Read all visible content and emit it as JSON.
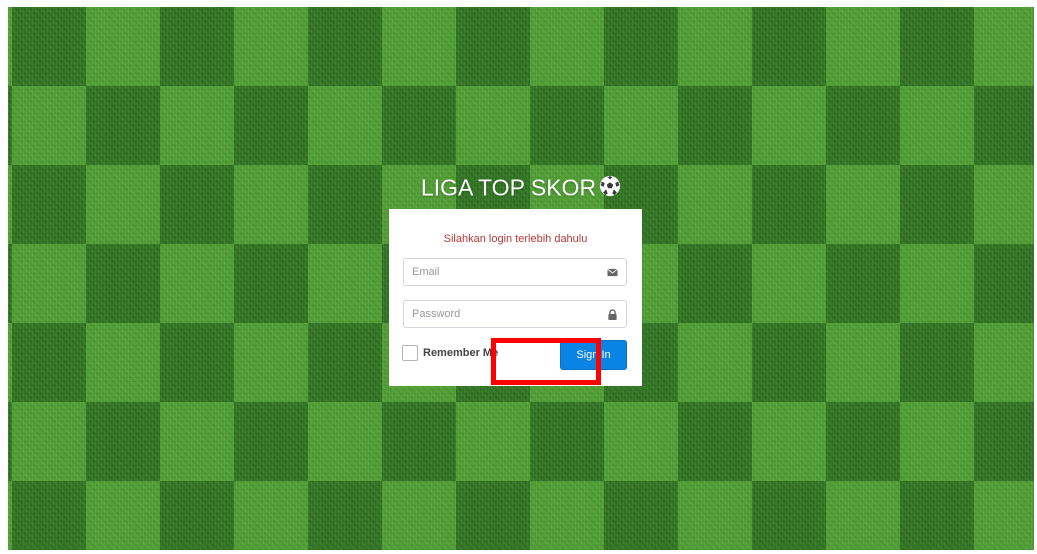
{
  "app": {
    "brand": "LIGA TOP SKOR",
    "logo_icon": "soccer-ball-icon"
  },
  "login": {
    "message": "Silahkan login terlebih dahulu",
    "email": {
      "placeholder": "Email",
      "value": "",
      "icon": "envelope-icon"
    },
    "password": {
      "placeholder": "Password",
      "value": "",
      "icon": "lock-icon"
    },
    "remember_label": "Remember Me",
    "remember_checked": false,
    "signin_label": "Sign In"
  },
  "colors": {
    "message": "#b43a3a",
    "signin_button": "#0a84e4",
    "highlight": "#ff0000"
  }
}
